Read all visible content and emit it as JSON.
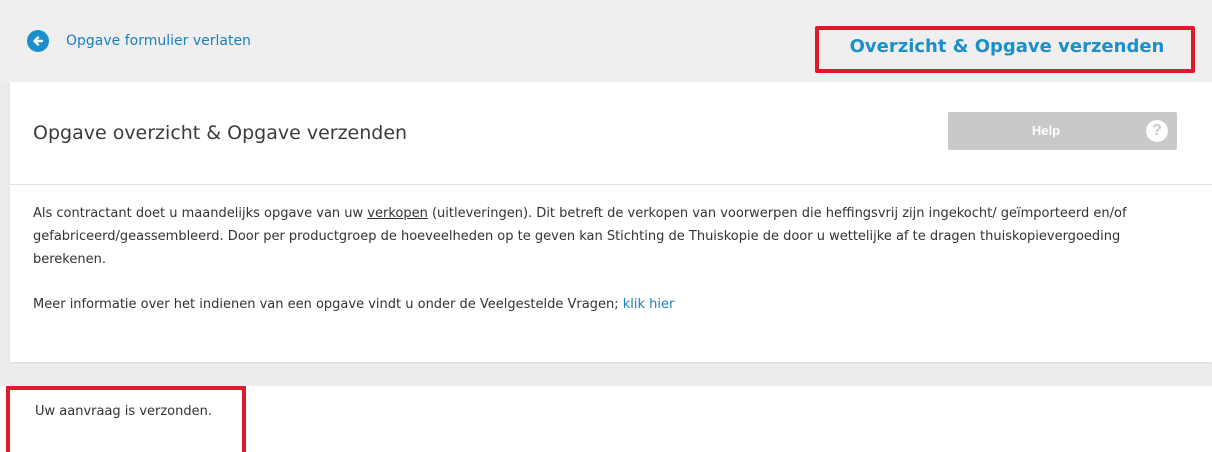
{
  "topbar": {
    "back_label": "Opgave formulier verlaten",
    "step_title": "Overzicht & Opgave verzenden"
  },
  "card": {
    "title": "Opgave overzicht & Opgave verzenden",
    "help_label": "Help",
    "help_icon": "?",
    "intro_before_link": "Als contractant doet u maandelijks opgave van uw ",
    "intro_link": "verkopen",
    "intro_after_link": " (uitleveringen). Dit betreft de verkopen van voorwerpen die heffingsvrij zijn ingekocht/ geïmporteerd en/of gefabriceerd/geassembleerd. Door per productgroep de hoeveelheden op te geven kan Stichting de Thuiskopie de door u wettelijke af te dragen thuiskopievergoeding berekenen.",
    "more_info_text": "Meer informatie over het indienen van een opgave vindt u onder de Veelgestelde Vragen; ",
    "more_info_link": "klik hier"
  },
  "confirmation": {
    "message": "Uw aanvraag is verzonden."
  },
  "colors": {
    "accent": "#1a8fc9",
    "highlight": "#e0182b",
    "help_button": "#c9c9c9"
  },
  "icons": {
    "back": "arrow-left-circle-icon",
    "help": "question-circle-icon"
  }
}
